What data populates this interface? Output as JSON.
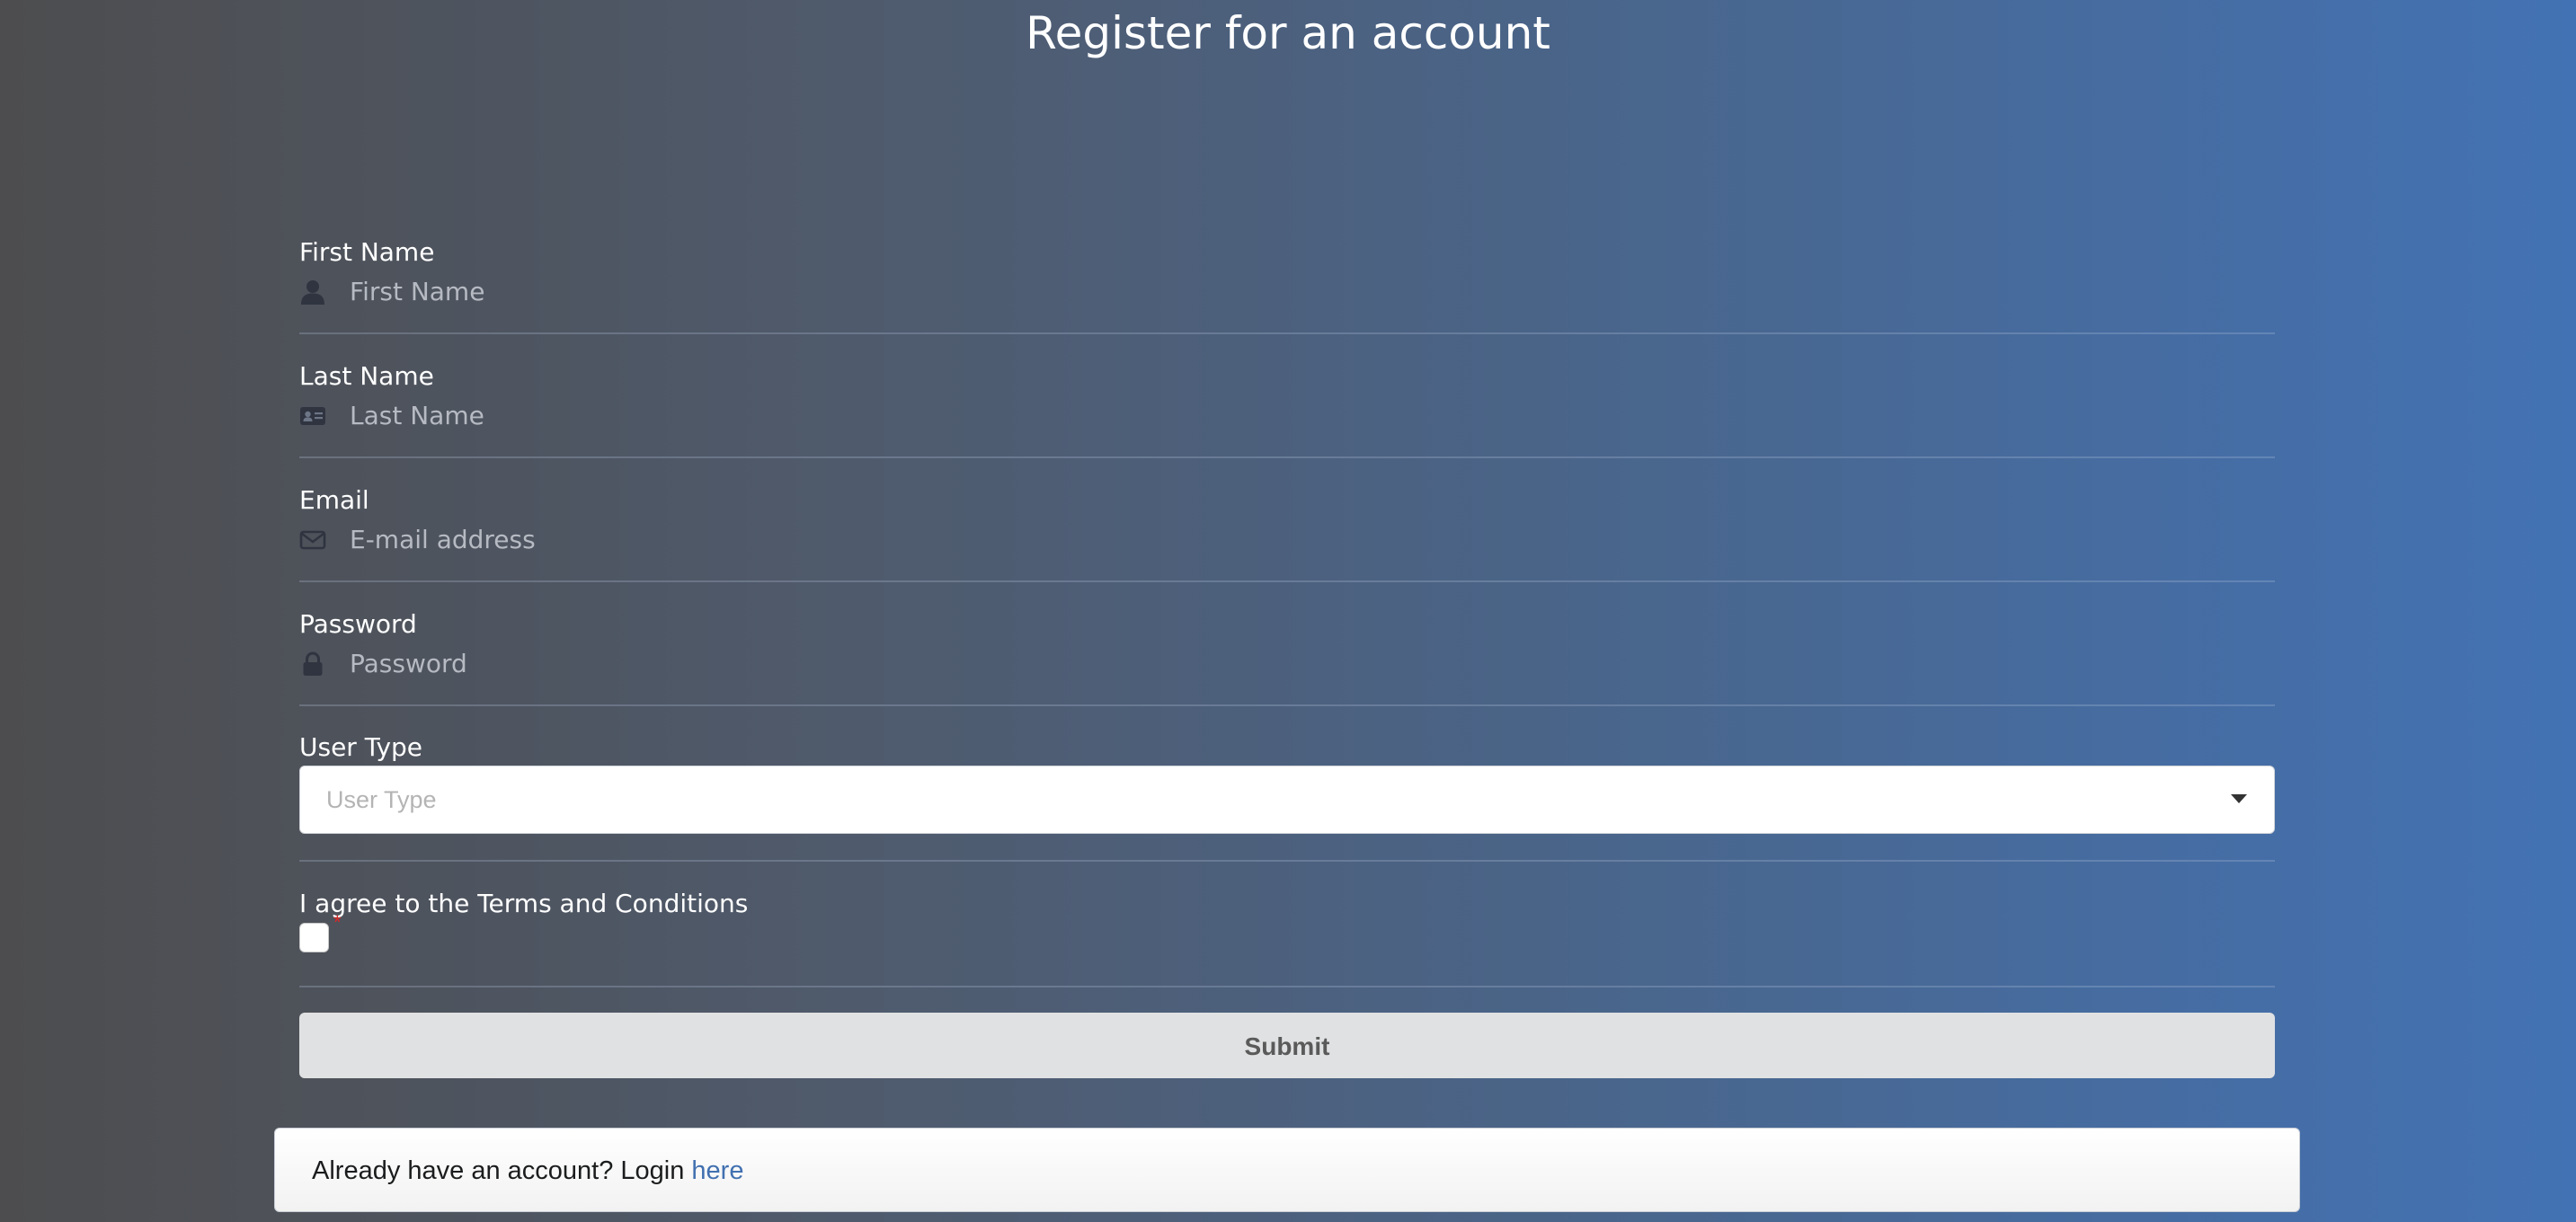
{
  "page": {
    "title": "Register for an account"
  },
  "form": {
    "first_name": {
      "label": "First Name",
      "placeholder": "First Name",
      "value": "",
      "icon": "user-icon"
    },
    "last_name": {
      "label": "Last Name",
      "placeholder": "Last Name",
      "value": "",
      "icon": "id-card-icon"
    },
    "email": {
      "label": "Email",
      "placeholder": "E-mail address",
      "value": "",
      "icon": "envelope-icon"
    },
    "password": {
      "label": "Password",
      "placeholder": "Password",
      "value": "",
      "icon": "lock-icon"
    },
    "user_type": {
      "label": "User Type",
      "placeholder": "User Type",
      "selected": ""
    },
    "terms": {
      "label": "I agree to the Terms and Conditions",
      "required_mark": "*",
      "checked": false
    },
    "submit_label": "Submit"
  },
  "login_message": {
    "text": "Already have an account? Login ",
    "link_text": "here"
  },
  "colors": {
    "background_start": "#4d4d4f",
    "background_end": "#4372b4",
    "link": "#4170b0",
    "required": "#db2828",
    "submit_bg": "#e0e1e2"
  }
}
